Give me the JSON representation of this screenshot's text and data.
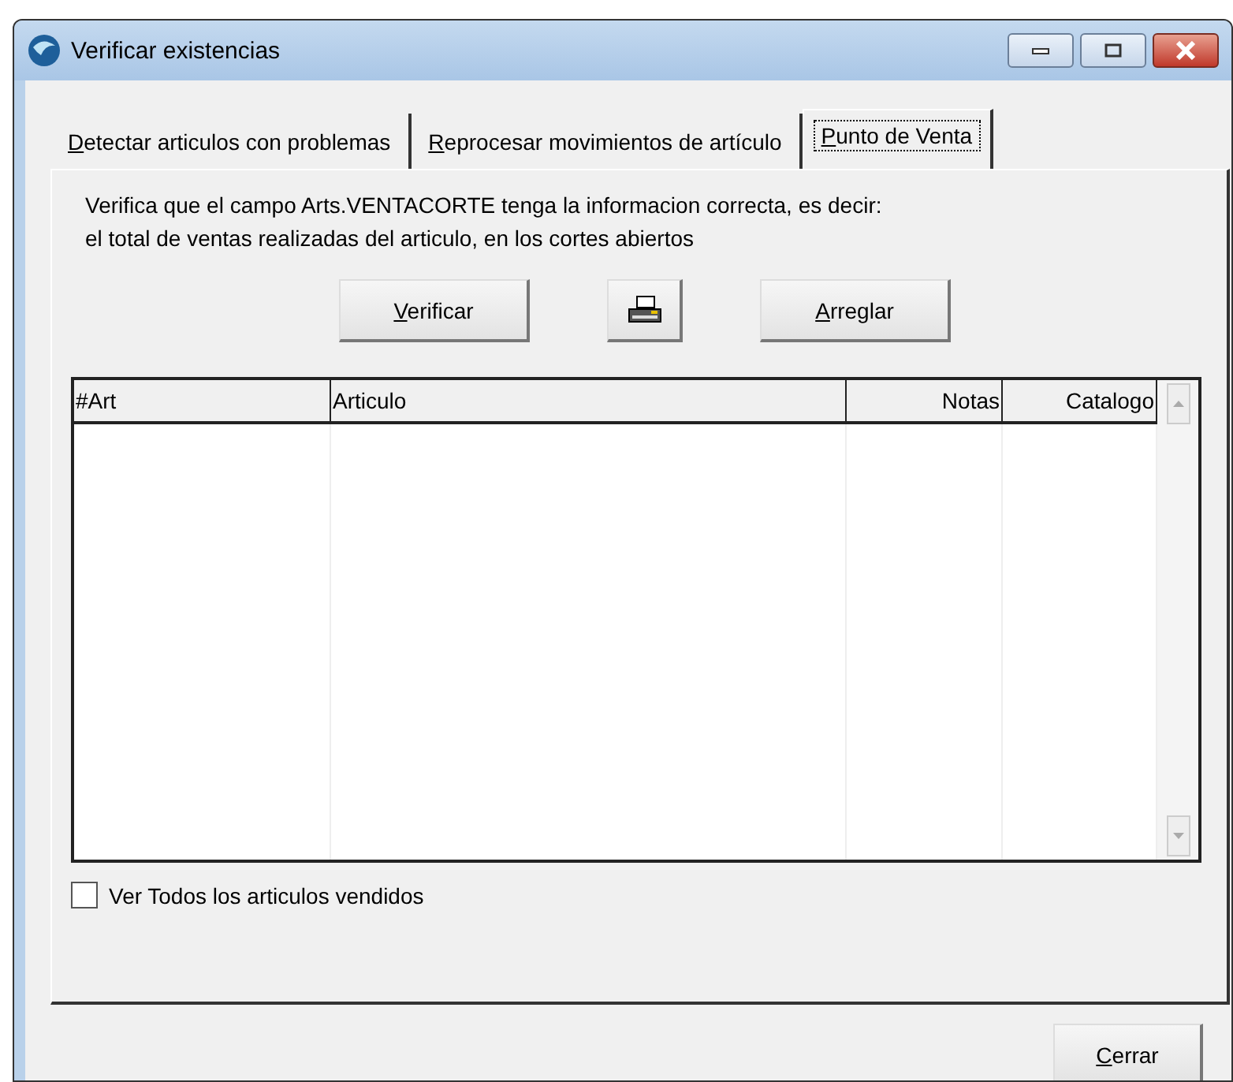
{
  "window": {
    "title": "Verificar existencias"
  },
  "tabs": [
    {
      "label": "Detectar articulos con problemas",
      "selected": false
    },
    {
      "label": "Reprocesar movimientos de artículo",
      "selected": false
    },
    {
      "label": "Punto de Venta",
      "selected": true
    }
  ],
  "description": [
    "Verifica que el campo Arts.VENTACORTE tenga la informacion correcta, es decir:",
    "el total de ventas realizadas del articulo, en los cortes abiertos"
  ],
  "actions": [
    {
      "kind": "text",
      "label": "Verificar"
    },
    {
      "kind": "print"
    },
    {
      "kind": "text",
      "label": "Arreglar"
    }
  ],
  "table": {
    "columns": [
      {
        "label": "#Art"
      },
      {
        "label": "Articulo"
      },
      {
        "label": "Notas"
      },
      {
        "label": "Catalogo"
      }
    ]
  },
  "checkbox": {
    "label": "Ver Todos los articulos vendidos",
    "checked": false
  },
  "close_button": {
    "label": "Cerrar"
  }
}
